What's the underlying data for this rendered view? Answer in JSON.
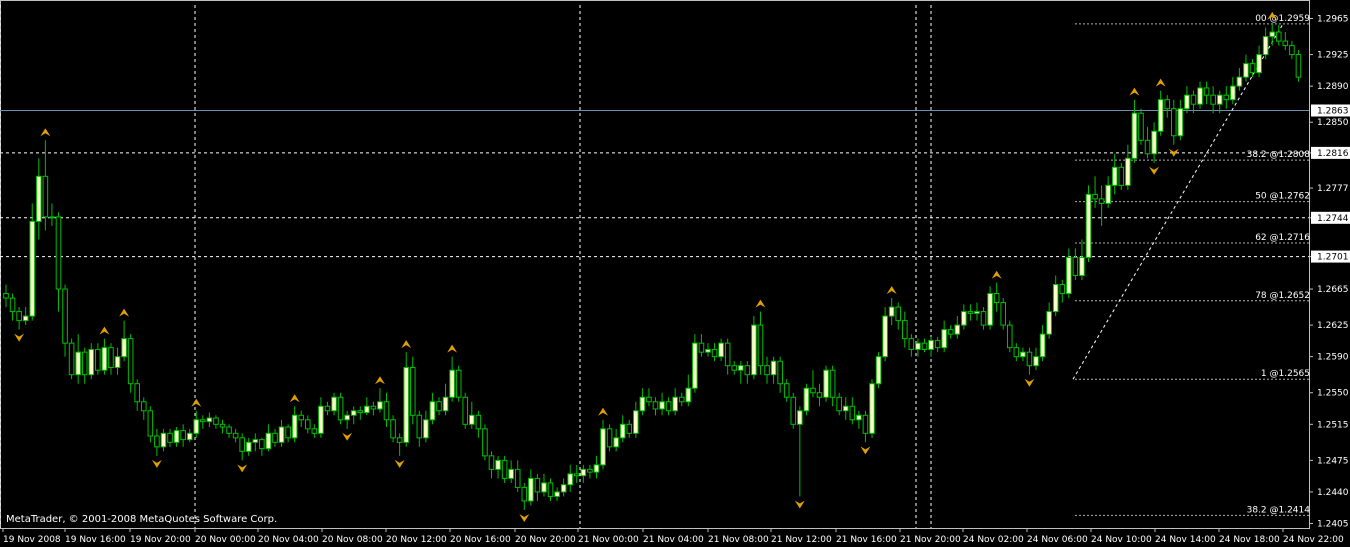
{
  "copyright": "MetaTrader, © 2001-2008 MetaQuotes Software Corp.",
  "colors": {
    "background": "#000000",
    "bull_candle": "#ffffcc",
    "bear_candle": "#000000",
    "wick": "#00c000",
    "fractal": "#e0a000",
    "grid": "#ffffff",
    "fib_line": "#b0b0b0",
    "current_price_line": "#7090b0"
  },
  "chart_data": {
    "type": "candlestick",
    "title": "",
    "ylim": [
      1.24,
      1.298
    ],
    "current_price": 1.2863,
    "y_ticks": [
      "1.2965",
      "1.2925",
      "1.2890",
      "1.2850",
      "1.2816",
      "1.2777",
      "1.2744",
      "1.2701",
      "1.2665",
      "1.2625",
      "1.2590",
      "1.2550",
      "1.2515",
      "1.2475",
      "1.2440",
      "1.2405"
    ],
    "highlighted_levels": [
      "1.2863",
      "1.2816",
      "1.2744",
      "1.2701"
    ],
    "x_ticks": [
      "19 Nov 2008",
      "19 Nov 16:00",
      "19 Nov 20:00",
      "20 Nov 00:00",
      "20 Nov 04:00",
      "20 Nov 08:00",
      "20 Nov 12:00",
      "20 Nov 16:00",
      "20 Nov 20:00",
      "21 Nov 00:00",
      "21 Nov 04:00",
      "21 Nov 08:00",
      "21 Nov 12:00",
      "21 Nov 16:00",
      "21 Nov 20:00",
      "24 Nov 02:00",
      "24 Nov 06:00",
      "24 Nov 10:00",
      "24 Nov 14:00",
      "24 Nov 18:00",
      "24 Nov 22:00"
    ],
    "horizontal_levels": [
      1.2816,
      1.2744,
      1.2701
    ],
    "fibonacci": {
      "low": 1.2565,
      "high": 1.2959,
      "levels": [
        {
          "label": "00 @1.2959",
          "value": 1.2959
        },
        {
          "label": "38.2 @1.2808",
          "value": 1.2808
        },
        {
          "label": "50 @1.2762",
          "value": 1.2762
        },
        {
          "label": "62 @1.2716",
          "value": 1.2716
        },
        {
          "label": "78 @1.2652",
          "value": 1.2652
        },
        {
          "label": "1 @1.2565",
          "value": 1.2565
        },
        {
          "label": "38.2 @1.2414",
          "value": 1.2414
        }
      ]
    },
    "candles": [
      [
        1.266,
        1.2655,
        1.267,
        1.2645
      ],
      [
        1.2655,
        1.264,
        1.266,
        1.263
      ],
      [
        1.264,
        1.263,
        1.2645,
        1.262
      ],
      [
        1.263,
        1.2635,
        1.2645,
        1.2625
      ],
      [
        1.2635,
        1.274,
        1.276,
        1.263
      ],
      [
        1.274,
        1.279,
        1.281,
        1.272
      ],
      [
        1.279,
        1.2745,
        1.283,
        1.273
      ],
      [
        1.2745,
        1.2745,
        1.276,
        1.2735
      ],
      [
        1.2745,
        1.2665,
        1.275,
        1.264
      ],
      [
        1.2665,
        1.2605,
        1.267,
        1.259
      ],
      [
        1.2605,
        1.257,
        1.261,
        1.2565
      ],
      [
        1.257,
        1.2595,
        1.2615,
        1.256
      ],
      [
        1.2595,
        1.257,
        1.26,
        1.256
      ],
      [
        1.257,
        1.2598,
        1.2605,
        1.2565
      ],
      [
        1.2598,
        1.2575,
        1.2605,
        1.257
      ],
      [
        1.2575,
        1.26,
        1.261,
        1.257
      ],
      [
        1.26,
        1.2578,
        1.2605,
        1.257
      ],
      [
        1.2578,
        1.259,
        1.26,
        1.257
      ],
      [
        1.259,
        1.261,
        1.263,
        1.2585
      ],
      [
        1.261,
        1.256,
        1.2615,
        1.255
      ],
      [
        1.256,
        1.254,
        1.2565,
        1.253
      ],
      [
        1.254,
        1.253,
        1.2545,
        1.252
      ],
      [
        1.253,
        1.2502,
        1.2535,
        1.2495
      ],
      [
        1.2502,
        1.249,
        1.251,
        1.248
      ],
      [
        1.249,
        1.2505,
        1.251,
        1.2485
      ],
      [
        1.2505,
        1.2495,
        1.251,
        1.249
      ],
      [
        1.2495,
        1.2508,
        1.2512,
        1.249
      ],
      [
        1.2508,
        1.2498,
        1.2515,
        1.249
      ],
      [
        1.2498,
        1.2505,
        1.251,
        1.2495
      ],
      [
        1.2505,
        1.252,
        1.253,
        1.25
      ],
      [
        1.252,
        1.2518,
        1.2525,
        1.251
      ],
      [
        1.2518,
        1.2522,
        1.2528,
        1.2512
      ],
      [
        1.2522,
        1.2515,
        1.2525,
        1.251
      ],
      [
        1.2515,
        1.2512,
        1.252,
        1.2505
      ],
      [
        1.2512,
        1.2505,
        1.2515,
        1.25
      ],
      [
        1.2505,
        1.25,
        1.251,
        1.2495
      ],
      [
        1.25,
        1.2485,
        1.2505,
        1.2475
      ],
      [
        1.2485,
        1.2495,
        1.25,
        1.248
      ],
      [
        1.2495,
        1.2498,
        1.2505,
        1.2485
      ],
      [
        1.2498,
        1.2488,
        1.25,
        1.248
      ],
      [
        1.2488,
        1.2505,
        1.2515,
        1.2485
      ],
      [
        1.2505,
        1.2495,
        1.251,
        1.249
      ],
      [
        1.2495,
        1.2512,
        1.252,
        1.249
      ],
      [
        1.2512,
        1.25,
        1.2515,
        1.2495
      ],
      [
        1.25,
        1.2525,
        1.2535,
        1.2495
      ],
      [
        1.2525,
        1.252,
        1.253,
        1.2512
      ],
      [
        1.252,
        1.251,
        1.2525,
        1.2505
      ],
      [
        1.251,
        1.2505,
        1.2515,
        1.25
      ],
      [
        1.2505,
        1.2535,
        1.2545,
        1.25
      ],
      [
        1.2535,
        1.253,
        1.254,
        1.2525
      ],
      [
        1.253,
        1.2545,
        1.255,
        1.2525
      ],
      [
        1.2545,
        1.252,
        1.255,
        1.2515
      ],
      [
        1.252,
        1.2525,
        1.253,
        1.251
      ],
      [
        1.2525,
        1.253,
        1.2535,
        1.2515
      ],
      [
        1.253,
        1.2528,
        1.2535,
        1.252
      ],
      [
        1.2528,
        1.2535,
        1.2545,
        1.2525
      ],
      [
        1.2535,
        1.2532,
        1.254,
        1.2525
      ],
      [
        1.2532,
        1.254,
        1.2555,
        1.2528
      ],
      [
        1.254,
        1.252,
        1.255,
        1.2512
      ],
      [
        1.252,
        1.25,
        1.2525,
        1.2495
      ],
      [
        1.25,
        1.2495,
        1.2505,
        1.248
      ],
      [
        1.2495,
        1.2578,
        1.2595,
        1.249
      ],
      [
        1.2578,
        1.2525,
        1.259,
        1.2515
      ],
      [
        1.2525,
        1.25,
        1.253,
        1.249
      ],
      [
        1.25,
        1.252,
        1.253,
        1.2495
      ],
      [
        1.252,
        1.254,
        1.255,
        1.2515
      ],
      [
        1.254,
        1.253,
        1.2545,
        1.2525
      ],
      [
        1.253,
        1.2545,
        1.256,
        1.2525
      ],
      [
        1.2545,
        1.2575,
        1.259,
        1.254
      ],
      [
        1.2575,
        1.2545,
        1.258,
        1.254
      ],
      [
        1.2545,
        1.2515,
        1.255,
        1.251
      ],
      [
        1.2515,
        1.2525,
        1.254,
        1.251
      ],
      [
        1.2525,
        1.251,
        1.253,
        1.25
      ],
      [
        1.251,
        1.248,
        1.2515,
        1.2475
      ],
      [
        1.248,
        1.2465,
        1.2485,
        1.2455
      ],
      [
        1.2465,
        1.2475,
        1.248,
        1.2455
      ],
      [
        1.2475,
        1.2455,
        1.248,
        1.245
      ],
      [
        1.2455,
        1.2465,
        1.2475,
        1.245
      ],
      [
        1.2465,
        1.2445,
        1.2475,
        1.244
      ],
      [
        1.2445,
        1.243,
        1.245,
        1.242
      ],
      [
        1.243,
        1.2455,
        1.2465,
        1.2425
      ],
      [
        1.2455,
        1.244,
        1.246,
        1.243
      ],
      [
        1.244,
        1.245,
        1.246,
        1.2435
      ],
      [
        1.245,
        1.2435,
        1.2455,
        1.243
      ],
      [
        1.2435,
        1.244,
        1.2445,
        1.243
      ],
      [
        1.244,
        1.2448,
        1.2455,
        1.2435
      ],
      [
        1.2448,
        1.246,
        1.247,
        1.244
      ],
      [
        1.246,
        1.2458,
        1.247,
        1.245
      ],
      [
        1.2458,
        1.2465,
        1.247,
        1.245
      ],
      [
        1.2465,
        1.2462,
        1.247,
        1.2455
      ],
      [
        1.2462,
        1.247,
        1.248,
        1.2455
      ],
      [
        1.247,
        1.251,
        1.252,
        1.2465
      ],
      [
        1.251,
        1.249,
        1.2515,
        1.2485
      ],
      [
        1.249,
        1.25,
        1.251,
        1.2485
      ],
      [
        1.25,
        1.2515,
        1.2525,
        1.2495
      ],
      [
        1.2515,
        1.2505,
        1.252,
        1.25
      ],
      [
        1.2505,
        1.253,
        1.254,
        1.25
      ],
      [
        1.253,
        1.2545,
        1.2555,
        1.2525
      ],
      [
        1.2545,
        1.254,
        1.2555,
        1.2535
      ],
      [
        1.254,
        1.2532,
        1.2545,
        1.2525
      ],
      [
        1.2532,
        1.254,
        1.255,
        1.2525
      ],
      [
        1.254,
        1.253,
        1.2545,
        1.2525
      ],
      [
        1.253,
        1.2545,
        1.2555,
        1.2525
      ],
      [
        1.2545,
        1.254,
        1.255,
        1.2535
      ],
      [
        1.254,
        1.2555,
        1.257,
        1.2535
      ],
      [
        1.2555,
        1.2605,
        1.2615,
        1.255
      ],
      [
        1.2605,
        1.2595,
        1.2615,
        1.259
      ],
      [
        1.2595,
        1.2598,
        1.2605,
        1.259
      ],
      [
        1.2598,
        1.259,
        1.2605,
        1.2585
      ],
      [
        1.259,
        1.2605,
        1.261,
        1.2585
      ],
      [
        1.2605,
        1.258,
        1.261,
        1.257
      ],
      [
        1.258,
        1.2575,
        1.2585,
        1.257
      ],
      [
        1.2575,
        1.258,
        1.2585,
        1.256
      ],
      [
        1.258,
        1.257,
        1.2585,
        1.256
      ],
      [
        1.257,
        1.2625,
        1.2635,
        1.2565
      ],
      [
        1.2625,
        1.258,
        1.264,
        1.257
      ],
      [
        1.258,
        1.257,
        1.259,
        1.256
      ],
      [
        1.257,
        1.2585,
        1.259,
        1.256
      ],
      [
        1.2585,
        1.256,
        1.259,
        1.255
      ],
      [
        1.256,
        1.2545,
        1.2565,
        1.254
      ],
      [
        1.2545,
        1.2515,
        1.255,
        1.251
      ],
      [
        1.2515,
        1.253,
        1.2535,
        1.2435
      ],
      [
        1.253,
        1.2555,
        1.256,
        1.2525
      ],
      [
        1.2555,
        1.255,
        1.2575,
        1.2545
      ],
      [
        1.255,
        1.2545,
        1.256,
        1.2535
      ],
      [
        1.2545,
        1.2575,
        1.258,
        1.254
      ],
      [
        1.2575,
        1.2545,
        1.258,
        1.2535
      ],
      [
        1.2545,
        1.253,
        1.255,
        1.2525
      ],
      [
        1.253,
        1.2535,
        1.2545,
        1.252
      ],
      [
        1.2535,
        1.252,
        1.2545,
        1.2515
      ],
      [
        1.252,
        1.2525,
        1.253,
        1.251
      ],
      [
        1.2525,
        1.2505,
        1.253,
        1.2495
      ],
      [
        1.2505,
        1.256,
        1.2565,
        1.25
      ],
      [
        1.256,
        1.259,
        1.2595,
        1.2555
      ],
      [
        1.259,
        1.2635,
        1.2645,
        1.2585
      ],
      [
        1.2635,
        1.2645,
        1.2655,
        1.2625
      ],
      [
        1.2645,
        1.263,
        1.265,
        1.262
      ],
      [
        1.263,
        1.261,
        1.264,
        1.26
      ],
      [
        1.261,
        1.2598,
        1.2615,
        1.259
      ],
      [
        1.2598,
        1.2605,
        1.261,
        1.259
      ],
      [
        1.2605,
        1.2598,
        1.261,
        1.2595
      ],
      [
        1.2598,
        1.2608,
        1.2612,
        1.259
      ],
      [
        1.2608,
        1.26,
        1.2612,
        1.2595
      ],
      [
        1.26,
        1.262,
        1.263,
        1.2595
      ],
      [
        1.262,
        1.2615,
        1.2625,
        1.261
      ],
      [
        1.2615,
        1.2625,
        1.2635,
        1.261
      ],
      [
        1.2625,
        1.264,
        1.2648,
        1.262
      ],
      [
        1.264,
        1.2638,
        1.2648,
        1.263
      ],
      [
        1.2638,
        1.264,
        1.265,
        1.263
      ],
      [
        1.264,
        1.2625,
        1.2645,
        1.262
      ],
      [
        1.2625,
        1.266,
        1.2668,
        1.262
      ],
      [
        1.266,
        1.265,
        1.2672,
        1.264
      ],
      [
        1.265,
        1.2625,
        1.2655,
        1.262
      ],
      [
        1.2625,
        1.26,
        1.263,
        1.2595
      ],
      [
        1.26,
        1.259,
        1.2605,
        1.2585
      ],
      [
        1.259,
        1.2595,
        1.26,
        1.2585
      ],
      [
        1.2595,
        1.258,
        1.26,
        1.257
      ],
      [
        1.258,
        1.259,
        1.26,
        1.2575
      ],
      [
        1.259,
        1.2615,
        1.2625,
        1.2585
      ],
      [
        1.2615,
        1.264,
        1.265,
        1.261
      ],
      [
        1.264,
        1.267,
        1.268,
        1.2635
      ],
      [
        1.267,
        1.266,
        1.2675,
        1.265
      ],
      [
        1.266,
        1.27,
        1.271,
        1.2655
      ],
      [
        1.27,
        1.268,
        1.271,
        1.2675
      ],
      [
        1.268,
        1.27,
        1.272,
        1.2675
      ],
      [
        1.27,
        1.277,
        1.278,
        1.2695
      ],
      [
        1.277,
        1.2765,
        1.279,
        1.2755
      ],
      [
        1.2765,
        1.276,
        1.278,
        1.2735
      ],
      [
        1.276,
        1.278,
        1.279,
        1.2755
      ],
      [
        1.278,
        1.28,
        1.2815,
        1.277
      ],
      [
        1.28,
        1.278,
        1.2805,
        1.2775
      ],
      [
        1.278,
        1.281,
        1.2825,
        1.2775
      ],
      [
        1.281,
        1.286,
        1.2875,
        1.2805
      ],
      [
        1.286,
        1.283,
        1.2865,
        1.2825
      ],
      [
        1.283,
        1.2815,
        1.2845,
        1.281
      ],
      [
        1.2815,
        1.284,
        1.285,
        1.2805
      ],
      [
        1.284,
        1.2875,
        1.2885,
        1.2835
      ],
      [
        1.2875,
        1.2865,
        1.288,
        1.2855
      ],
      [
        1.2865,
        1.2835,
        1.2875,
        1.2825
      ],
      [
        1.2835,
        1.2865,
        1.2875,
        1.283
      ],
      [
        1.2865,
        1.288,
        1.289,
        1.286
      ],
      [
        1.288,
        1.287,
        1.2885,
        1.286
      ],
      [
        1.287,
        1.2888,
        1.2895,
        1.2865
      ],
      [
        1.2888,
        1.288,
        1.2895,
        1.287
      ],
      [
        1.288,
        1.287,
        1.289,
        1.286
      ],
      [
        1.287,
        1.288,
        1.2885,
        1.286
      ],
      [
        1.288,
        1.2875,
        1.289,
        1.2865
      ],
      [
        1.2875,
        1.289,
        1.29,
        1.287
      ],
      [
        1.289,
        1.29,
        1.291,
        1.2885
      ],
      [
        1.29,
        1.2915,
        1.2925,
        1.2895
      ],
      [
        1.2915,
        1.2905,
        1.292,
        1.29
      ],
      [
        1.2905,
        1.2925,
        1.2935,
        1.29
      ],
      [
        1.2925,
        1.2945,
        1.2955,
        1.292
      ],
      [
        1.2945,
        1.295,
        1.2959,
        1.2935
      ],
      [
        1.295,
        1.294,
        1.2958,
        1.2935
      ],
      [
        1.294,
        1.2935,
        1.295,
        1.293
      ],
      [
        1.2935,
        1.2925,
        1.294,
        1.292
      ],
      [
        1.2925,
        1.29,
        1.293,
        1.2895
      ]
    ]
  }
}
